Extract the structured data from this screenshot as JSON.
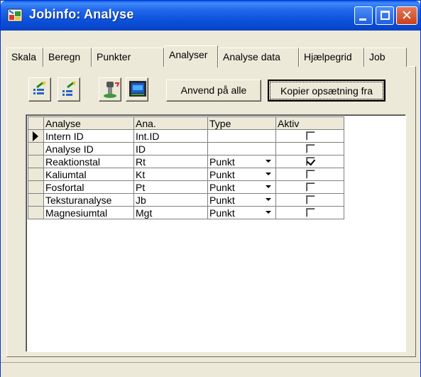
{
  "window": {
    "title": "Jobinfo: Analyse"
  },
  "tabs": [
    {
      "label": "Skala"
    },
    {
      "label": "Beregn"
    },
    {
      "label": "Punkter"
    },
    {
      "label": "Analyser",
      "active": true
    },
    {
      "label": "Analyse data"
    },
    {
      "label": "Hjælpegrid"
    },
    {
      "label": "Job"
    }
  ],
  "toolbar": {
    "apply_all_label": "Anvend på alle",
    "copy_setup_label": "Kopier opsætning fra"
  },
  "grid": {
    "columns": [
      "Analyse",
      "Ana.",
      "Type",
      "Aktiv"
    ],
    "rows": [
      {
        "analyse": "Intern ID",
        "ana": "Int.ID",
        "type": "",
        "aktiv": false,
        "current": true
      },
      {
        "analyse": "Analyse ID",
        "ana": "ID",
        "type": "",
        "aktiv": false
      },
      {
        "analyse": "Reaktionstal",
        "ana": "Rt",
        "type": "Punkt",
        "aktiv": true
      },
      {
        "analyse": "Kaliumtal",
        "ana": "Kt",
        "type": "Punkt",
        "aktiv": false
      },
      {
        "analyse": "Fosfortal",
        "ana": "Pt",
        "type": "Punkt",
        "aktiv": false
      },
      {
        "analyse": "Teksturanalyse",
        "ana": "Jb",
        "type": "Punkt",
        "aktiv": false
      },
      {
        "analyse": "Magnesiumtal",
        "ana": "Mgt",
        "type": "Punkt",
        "aktiv": false
      }
    ]
  }
}
